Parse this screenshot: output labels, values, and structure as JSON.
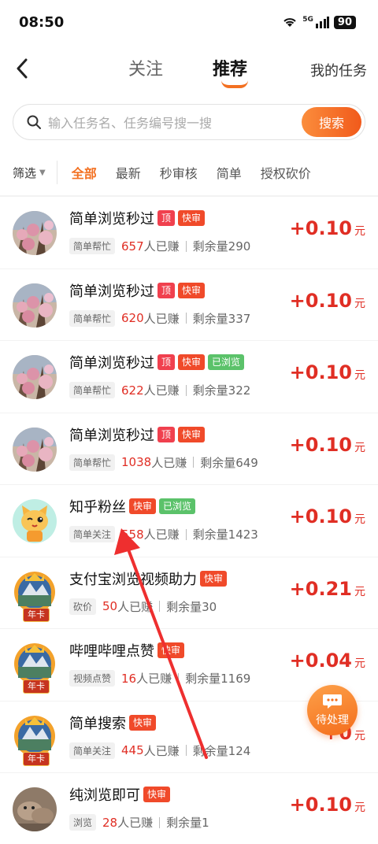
{
  "status": {
    "time": "08:50",
    "battery": "90",
    "network": "5G"
  },
  "nav": {
    "tabs": [
      "关注",
      "推荐"
    ],
    "active_tab": "推荐",
    "my_tasks": "我的任务"
  },
  "search": {
    "placeholder": "输入任务名、任务编号搜一搜",
    "button": "搜索"
  },
  "filter": {
    "label": "筛选",
    "categories": [
      "全部",
      "最新",
      "秒审核",
      "简单",
      "授权砍价"
    ],
    "active": "全部"
  },
  "tasks": [
    {
      "title": "简单浏览秒过",
      "tags": [
        "顶",
        "快审"
      ],
      "type": "简单帮忙",
      "earned": "657",
      "earned_suffix": "人已赚",
      "remaining": "剩余量290",
      "reward": "+0.10",
      "unit": "元",
      "avatar": "flowers"
    },
    {
      "title": "简单浏览秒过",
      "tags": [
        "顶",
        "快审"
      ],
      "type": "简单帮忙",
      "earned": "620",
      "earned_suffix": "人已赚",
      "remaining": "剩余量337",
      "reward": "+0.10",
      "unit": "元",
      "avatar": "flowers"
    },
    {
      "title": "简单浏览秒过",
      "tags": [
        "顶",
        "快审",
        "已浏览"
      ],
      "type": "简单帮忙",
      "earned": "622",
      "earned_suffix": "人已赚",
      "remaining": "剩余量322",
      "reward": "+0.10",
      "unit": "元",
      "avatar": "flowers"
    },
    {
      "title": "简单浏览秒过",
      "tags": [
        "顶",
        "快审"
      ],
      "type": "简单帮忙",
      "earned": "1038",
      "earned_suffix": "人已赚",
      "remaining": "剩余量649",
      "reward": "+0.10",
      "unit": "元",
      "avatar": "flowers"
    },
    {
      "title": "知乎粉丝",
      "tags": [
        "快审",
        "已浏览"
      ],
      "type": "简单关注",
      "earned": "558",
      "earned_suffix": "人已赚",
      "remaining": "剩余量1423",
      "reward": "+0.10",
      "unit": "元",
      "avatar": "cat"
    },
    {
      "title": "支付宝浏览视频助力",
      "tags": [
        "快审"
      ],
      "type": "砍价",
      "earned": "50",
      "earned_suffix": "人已赚",
      "remaining": "剩余量30",
      "reward": "+0.21",
      "unit": "元",
      "avatar": "annual",
      "badge": "年卡"
    },
    {
      "title": "哔哩哔哩点赞",
      "tags": [
        "快审"
      ],
      "type": "视频点赞",
      "earned": "16",
      "earned_suffix": "人已赚",
      "remaining": "剩余量1169",
      "reward": "+0.04",
      "unit": "元",
      "avatar": "annual",
      "badge": "年卡"
    },
    {
      "title": "简单搜索",
      "tags": [
        "快审"
      ],
      "type": "简单关注",
      "earned": "445",
      "earned_suffix": "人已赚",
      "remaining": "剩余量124",
      "reward": "+0",
      "unit": "元",
      "avatar": "annual",
      "badge": "年卡"
    },
    {
      "title": "纯浏览即可",
      "tags": [
        "快审"
      ],
      "type": "浏览",
      "earned": "28",
      "earned_suffix": "人已赚",
      "remaining": "剩余量1",
      "reward": "+0.10",
      "unit": "元",
      "avatar": "dog"
    }
  ],
  "floating": {
    "label": "待处理",
    "icon": "chat-bubble-icon"
  },
  "colors": {
    "accent": "#f37021",
    "price": "#e02e24",
    "tag_top": "#f0404e",
    "tag_fast": "#f04a2a",
    "tag_viewed": "#5bc26a"
  }
}
